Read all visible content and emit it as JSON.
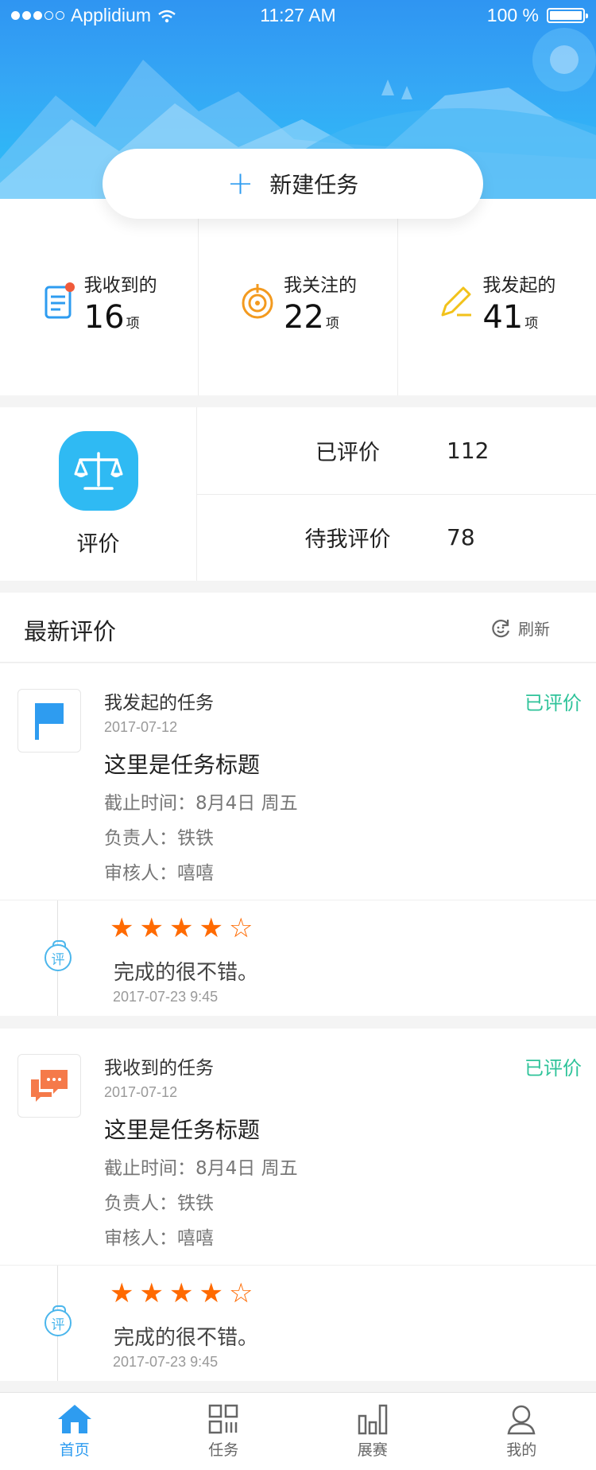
{
  "status_bar": {
    "carrier": "Applidium",
    "time": "11:27 AM",
    "battery": "100 %"
  },
  "new_task": {
    "label": "新建任务"
  },
  "stats": [
    {
      "title": "我收到的",
      "count": "16",
      "unit": "项",
      "icon": "clipboard-icon"
    },
    {
      "title": "我关注的",
      "count": "22",
      "unit": "项",
      "icon": "target-icon"
    },
    {
      "title": "我发起的",
      "count": "41",
      "unit": "项",
      "icon": "pencil-icon"
    }
  ],
  "evaluation": {
    "label": "评价",
    "icon": "scale-icon",
    "rows": [
      {
        "label": "已评价",
        "value": "112"
      },
      {
        "label": "待我评价",
        "value": "78"
      }
    ]
  },
  "latest": {
    "title": "最新评价",
    "refresh": "刷新"
  },
  "cards": [
    {
      "icon": "flag-icon",
      "type": "我发起的任务",
      "status": "已评价",
      "date": "2017-07-12",
      "title": "这里是任务标题",
      "deadline": "截止时间：8月4日  周五",
      "owner": "负责人：铁铁",
      "reviewer": "审核人：嘻嘻",
      "badge": "评",
      "rating": 4,
      "rating_max": 5,
      "comment": "完成的很不错。",
      "comment_time": "2017-07-23 9:45"
    },
    {
      "icon": "chat-icon",
      "type": "我收到的任务",
      "status": "已评价",
      "date": "2017-07-12",
      "title": "这里是任务标题",
      "deadline": "截止时间：8月4日  周五",
      "owner": "负责人：铁铁",
      "reviewer": "审核人：嘻嘻",
      "badge": "评",
      "rating": 4,
      "rating_max": 5,
      "comment": "完成的很不错。",
      "comment_time": "2017-07-23 9:45"
    }
  ],
  "tabs": [
    {
      "label": "首页",
      "icon": "home-icon",
      "active": true
    },
    {
      "label": "任务",
      "icon": "grid-icon",
      "active": false
    },
    {
      "label": "展赛",
      "icon": "bar-chart-icon",
      "active": false
    },
    {
      "label": "我的",
      "icon": "user-icon",
      "active": false
    }
  ],
  "colors": {
    "primary": "#2e9cf0",
    "status_done": "#2fc39a",
    "star": "#ff6a00",
    "evaluation_icon_bg": "#2fbaf3"
  }
}
